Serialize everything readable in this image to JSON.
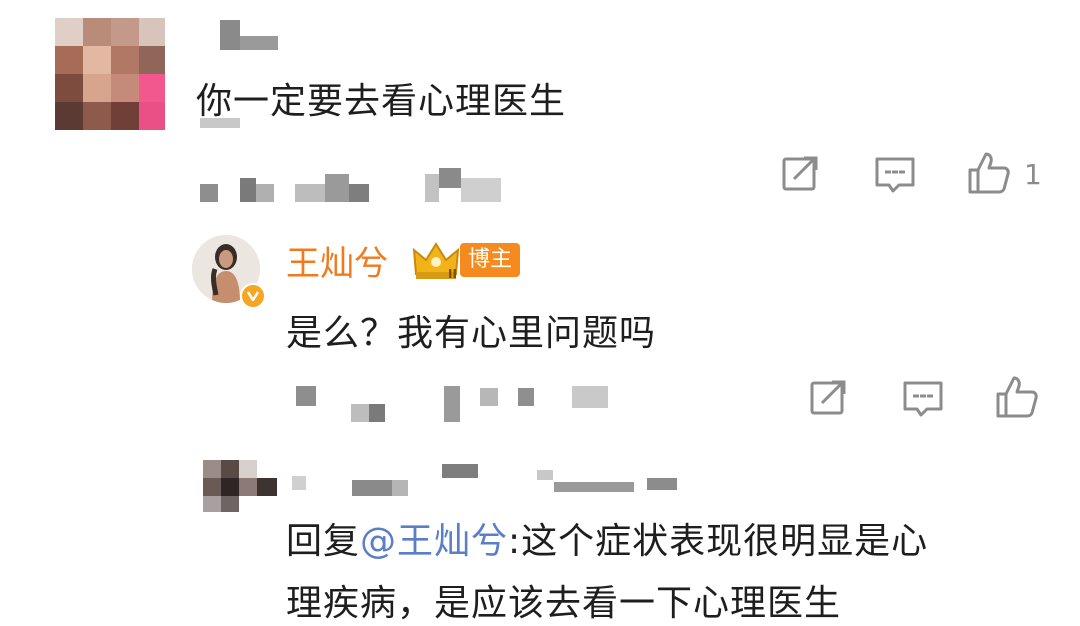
{
  "comment1": {
    "text": "你一定要去看心理医生",
    "like_count": "1",
    "icons": [
      "share-icon",
      "comment-icon",
      "like-icon"
    ]
  },
  "reply1": {
    "username": "王灿兮",
    "badge_label": "博主",
    "text": "是么？我有心里问题吗",
    "icons": [
      "share-icon",
      "comment-icon",
      "like-icon"
    ]
  },
  "reply2": {
    "reply_prefix": "回复",
    "mention": "@王灿兮",
    "line1_rest": ":这个症状表现很明显是心",
    "line2": "理疾病，是应该去看一下心理医生"
  },
  "colors": {
    "username": "#f07a1e",
    "mention": "#5b7fc7",
    "badge": "#f58a1f",
    "icon": "#8c8c8c"
  }
}
